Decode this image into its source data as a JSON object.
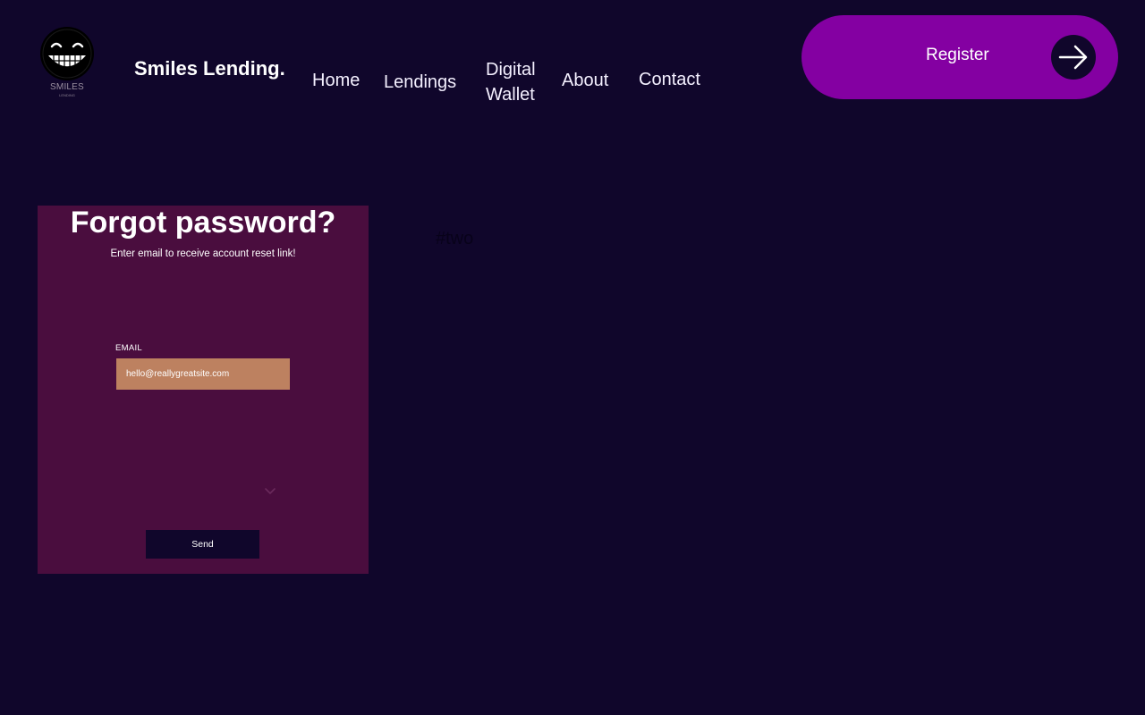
{
  "header": {
    "logo_text": "SMILES",
    "logo_subtext": "LENDING",
    "brand": "Smiles Lending.",
    "nav": {
      "home": "Home",
      "lendings": "Lendings",
      "digital_wallet": "Digital Wallet",
      "about": "About",
      "contact": "Contact"
    },
    "register_label": "Register"
  },
  "form": {
    "title": "Forgot password?",
    "subtitle": "Enter email to receive account reset link!",
    "email_label": "EMAIL",
    "email_value": "hello@reallygreatsite.com",
    "send_label": "Send"
  },
  "anchor_text": "#two",
  "colors": {
    "background": "#10062b",
    "panel": "#4a0d3e",
    "accent": "#8400a2",
    "input": "#bd8160"
  },
  "icons": [
    "smiley-logo-icon",
    "arrow-right-icon",
    "chevron-down-icon"
  ]
}
